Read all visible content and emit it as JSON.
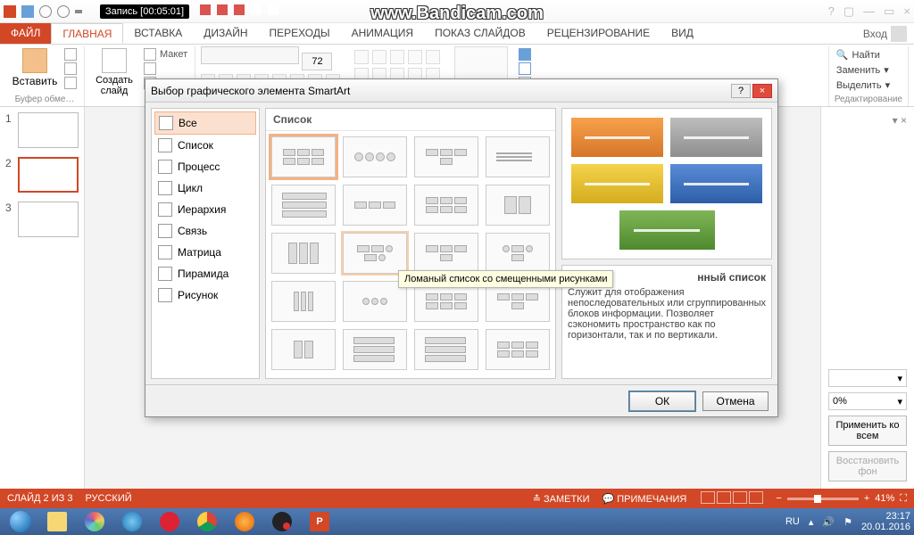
{
  "watermark": "www.Bandicam.com",
  "recording": {
    "label": "Запись [00:05:01]"
  },
  "window_controls": {
    "help": "?",
    "opts": "▢",
    "min": "—",
    "max": "▭",
    "close": "×"
  },
  "tabs": {
    "file": "ФАЙЛ",
    "items": [
      "ГЛАВНАЯ",
      "ВСТАВКА",
      "ДИЗАЙН",
      "ПЕРЕХОДЫ",
      "АНИМАЦИЯ",
      "ПОКАЗ СЛАЙДОВ",
      "РЕЦЕНЗИРОВАНИЕ",
      "ВИД"
    ],
    "active": "ГЛАВНАЯ",
    "login": "Вход"
  },
  "ribbon": {
    "clipboard": {
      "paste": "Вставить",
      "group": "Буфер обме…"
    },
    "slides": {
      "new": "Создать слайд",
      "layout": "Макет",
      "reset": "",
      "section": ""
    },
    "font": {
      "size": "72"
    },
    "editing": {
      "find": "Найти",
      "replace": "Заменить",
      "select": "Выделить",
      "group": "Редактирование"
    }
  },
  "slides": {
    "count": 3,
    "active": 2
  },
  "right_panel": {
    "pct": "0%",
    "apply_all": "Применить ко всем",
    "reset_bg": "Восстановить фон"
  },
  "status": {
    "slide": "СЛАЙД 2 ИЗ 3",
    "lang": "РУССКИЙ",
    "notes": "ЗАМЕТКИ",
    "comments": "ПРИМЕЧАНИЯ",
    "zoom": "41%"
  },
  "taskbar": {
    "lang": "RU",
    "time": "23:17",
    "date": "20.01.2016"
  },
  "dialog": {
    "title": "Выбор графического элемента SmartArt",
    "categories": [
      "Все",
      "Список",
      "Процесс",
      "Цикл",
      "Иерархия",
      "Связь",
      "Матрица",
      "Пирамида",
      "Рисунок"
    ],
    "selected_category": "Все",
    "gallery_header": "Список",
    "tooltip": "Ломаный список со смещенными рисунками",
    "preview_title": "нный список",
    "preview_desc": "Служит для отображения непоследовательных или сгруппированных блоков информации. Позволяет сэкономить пространство как по горизонтали, так и по вертикали.",
    "ok": "ОК",
    "cancel": "Отмена"
  }
}
